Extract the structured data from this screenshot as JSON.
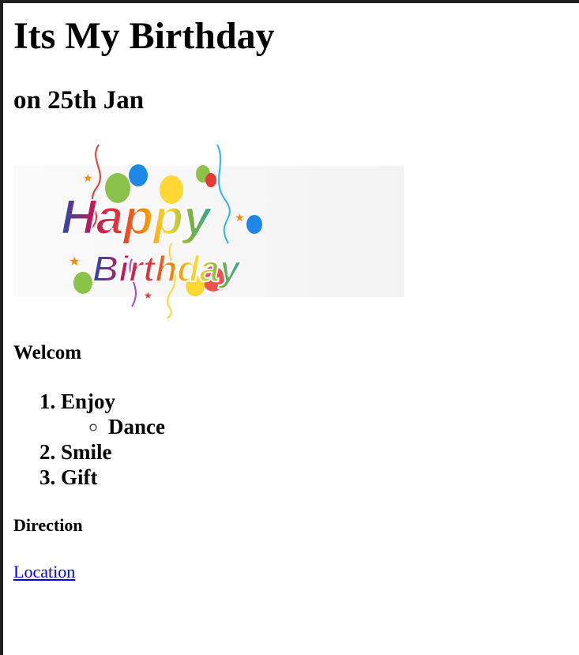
{
  "page": {
    "title": "Its My Birthday",
    "date_heading": "on 25th Jan",
    "banner_text": "Happy Birthday",
    "welcome_heading": "Welcom",
    "list": {
      "items": [
        {
          "label": "Enjoy",
          "subitems": [
            "Dance"
          ]
        },
        {
          "label": "Smile"
        },
        {
          "label": "Gift"
        }
      ]
    },
    "direction_heading": "Direction",
    "location_link": "Location"
  },
  "colors": {
    "link": "#0000ee",
    "frame": "#1f1f1f"
  }
}
